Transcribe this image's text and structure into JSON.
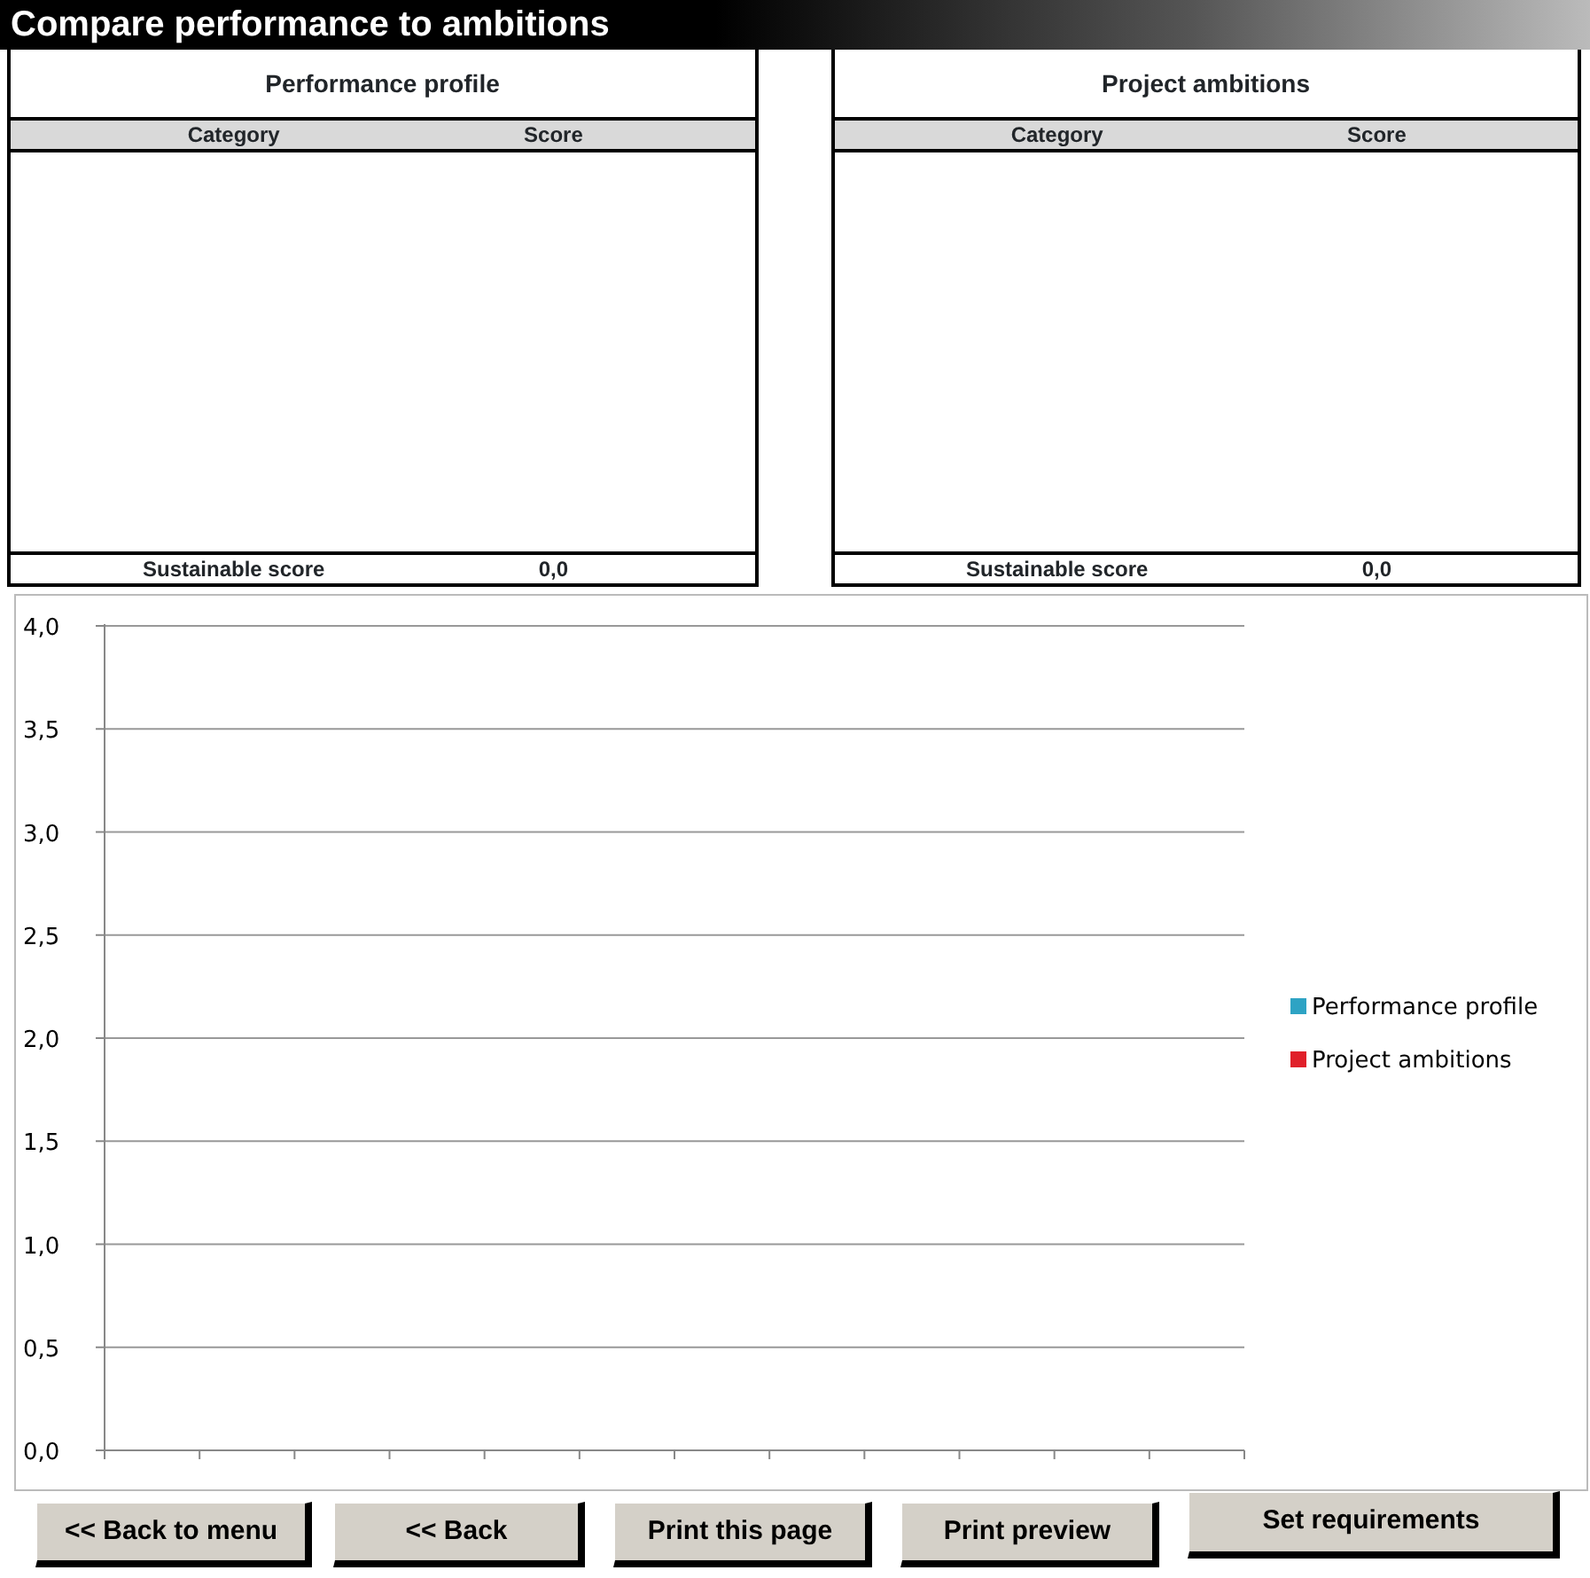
{
  "title": "Compare performance to ambitions",
  "tables": [
    {
      "title": "Performance profile",
      "columns": [
        "Category",
        "Score"
      ],
      "footer": {
        "label": "Sustainable score",
        "value": "0,0"
      }
    },
    {
      "title": "Project ambitions",
      "columns": [
        "Category",
        "Score"
      ],
      "footer": {
        "label": "Sustainable score",
        "value": "0,0"
      }
    }
  ],
  "chart": {
    "chart_data": {
      "type": "bar",
      "grid": true,
      "ylim": [
        0,
        4
      ],
      "yticks": [
        {
          "value": 0,
          "label": "0,0"
        },
        {
          "value": 0.5,
          "label": "0,5"
        },
        {
          "value": 1,
          "label": "1,0"
        },
        {
          "value": 1.5,
          "label": "1,5"
        },
        {
          "value": 2,
          "label": "2,0"
        },
        {
          "value": 2.5,
          "label": "2,5"
        },
        {
          "value": 3,
          "label": "3,0"
        },
        {
          "value": 3.5,
          "label": "3,5"
        },
        {
          "value": 4,
          "label": "4,0"
        }
      ],
      "series": [
        {
          "name": "Performance profile",
          "color": "#2ea3c4"
        },
        {
          "name": "Project ambitions",
          "color": "#e0202a"
        }
      ]
    }
  },
  "buttons": [
    {
      "label": "<< Back to menu",
      "raised": false
    },
    {
      "label": "<< Back",
      "raised": false
    },
    {
      "label": "Print this page",
      "raised": false
    },
    {
      "label": "Print preview",
      "raised": false
    },
    {
      "label": "Set requirements",
      "raised": true
    }
  ]
}
